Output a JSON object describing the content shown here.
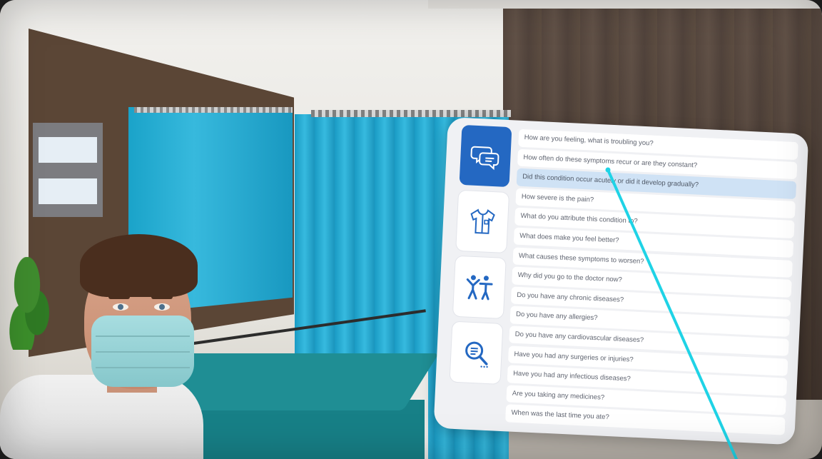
{
  "scene": {
    "laser_color": "#1fd3e6",
    "curtain_color": "#1aa3c9",
    "panel_accent": "#2468c2"
  },
  "panel": {
    "tabs": [
      {
        "icon": "speech-bubbles-icon",
        "active": true
      },
      {
        "icon": "shirt-icon",
        "active": false
      },
      {
        "icon": "body-figures-icon",
        "active": false
      },
      {
        "icon": "magnifier-icon",
        "active": false
      }
    ],
    "questions": [
      "How are you feeling, what is troubling you?",
      "How often do these symptoms recur or are they constant?",
      "Did this condition occur acutely or did it develop gradually?",
      "How severe is the pain?",
      "What do you attribute this condition to?",
      "What does make you feel better?",
      "What causes these symptoms to worsen?",
      "Why did you go to the doctor now?",
      "Do you have any chronic diseases?",
      "Do you have any allergies?",
      "Do you have any cardiovascular diseases?",
      "Have you had any surgeries or injuries?",
      "Have you had any infectious diseases?",
      "Are you taking any medicines?",
      "When was the last time you ate?"
    ],
    "selected_index": 2
  }
}
